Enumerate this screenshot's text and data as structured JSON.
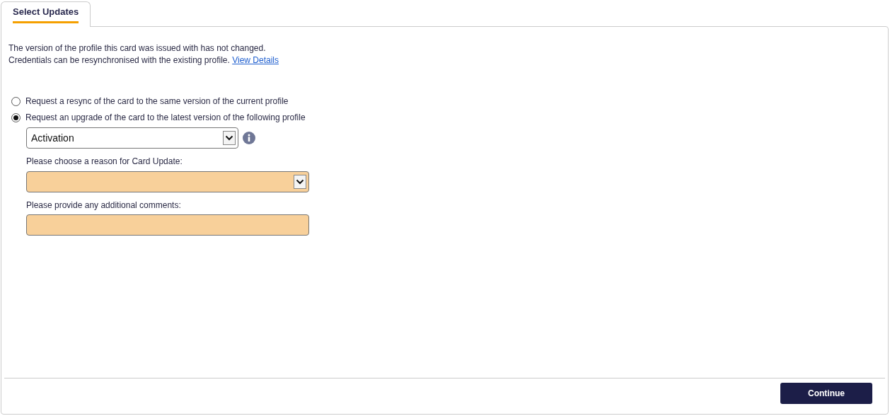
{
  "tabs": [
    {
      "label": "Select Updates",
      "selected": true
    }
  ],
  "message": {
    "line_1": "The version of the profile this card was issued with has not changed.",
    "line_2": "Credentials can be resynchronised with the existing profile.",
    "link": "View Details"
  },
  "options": [
    {
      "label": "Request a resync of the card to the same version of the current profile",
      "selected": false
    },
    {
      "label": "Request an upgrade of the card to the latest version of the following profile",
      "selected": true
    }
  ],
  "profile_select": {
    "value": "Activation"
  },
  "reason_select": {
    "label": "Please choose a reason for Card Update:"
  },
  "comments_field": {
    "label": "Please provide any additional comments:"
  },
  "buttons": [
    {
      "label": "Continue"
    }
  ]
}
